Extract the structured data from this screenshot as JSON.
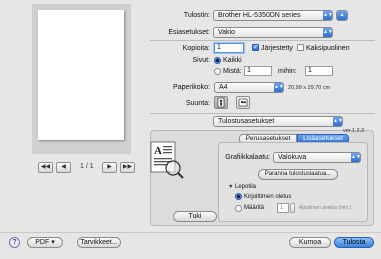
{
  "preview": {
    "first_label": "◀◀",
    "prev_label": "◀",
    "page_count": "1 / 1",
    "next_label": "▶",
    "last_label": "▶▶"
  },
  "printer": {
    "label": "Tulostin:",
    "value": "Brother HL-5350DN series"
  },
  "presets": {
    "label": "Esiasetukset:",
    "value": "Vakio"
  },
  "copies": {
    "label": "Kopioita:",
    "value": "1",
    "collated_label": "Järjestetty",
    "collated": true,
    "duplex_label": "Kaksipuolinen",
    "duplex": false
  },
  "pages": {
    "label": "Sivut:",
    "all_label": "Kaikki",
    "from_label": "Mistä:",
    "from_value": "1",
    "to_label": "mihin:",
    "to_value": "1"
  },
  "paper_size": {
    "label": "Paperikoko:",
    "value": "A4",
    "dimensions": "20,99 x 29,70 cm"
  },
  "orientation": {
    "label": "Suunta:"
  },
  "panel": {
    "value": "Tulostusasetukset"
  },
  "tabs": {
    "basic": "Perusasetukset",
    "advanced": "Lisäasetukset"
  },
  "version": "ver.1.2.3",
  "graphics": {
    "label": "Grafiikkalaatu:",
    "value": "Valokuva"
  },
  "improve_button": "Paranna tulostuslaatua...",
  "sleep": {
    "heading": "Lepotila",
    "default_label": "Kirjoittimen oletus",
    "custom_label": "Määritä",
    "custom_value": "1",
    "unit_label": "Ajastimen asetus (min.)"
  },
  "support_button": "Tuki",
  "footer": {
    "help": "?",
    "pdf_label": "PDF ▾",
    "supplies_label": "Tarvikkeet...",
    "cancel_label": "Kumoa",
    "print_label": "Tulosta"
  },
  "colors": {
    "accent": "#3b82e0",
    "background": "#e6e6e6"
  }
}
